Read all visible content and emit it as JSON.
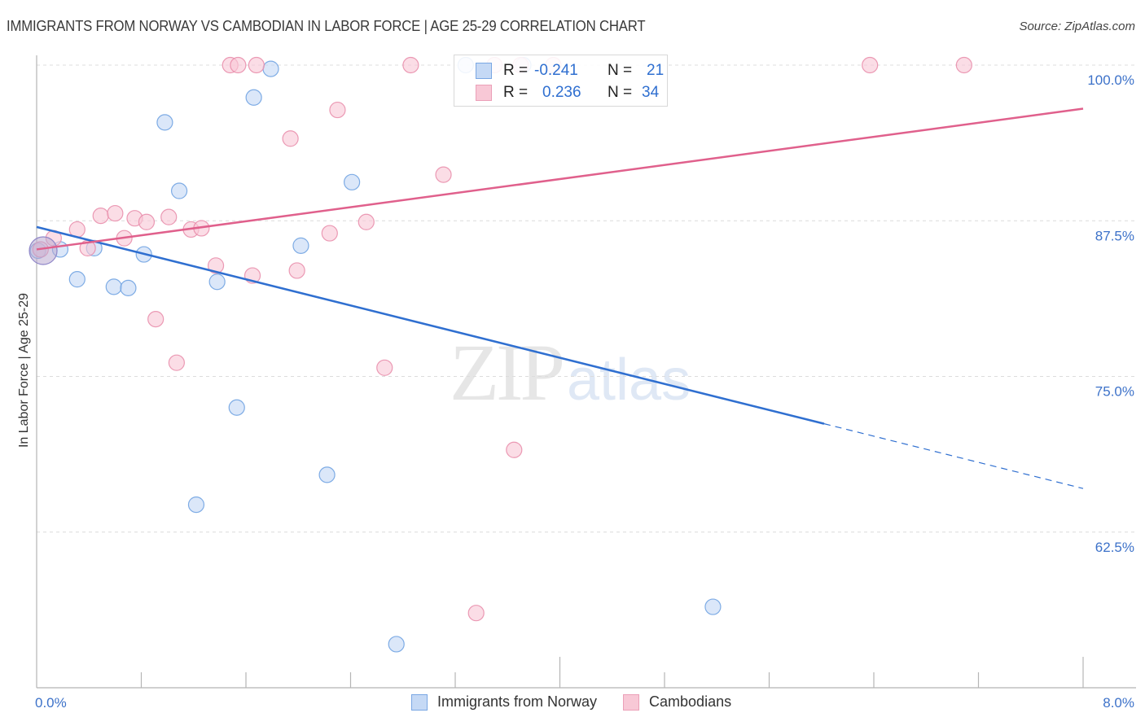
{
  "header": {
    "title": "IMMIGRANTS FROM NORWAY VS CAMBODIAN IN LABOR FORCE | AGE 25-29 CORRELATION CHART",
    "source": "Source: ZipAtlas.com"
  },
  "watermark": {
    "zip": "ZIP",
    "atlas": "atlas"
  },
  "legend": {
    "r_label": "R =",
    "n_label": "N =",
    "series": [
      {
        "name": "Immigrants from Norway",
        "r": "-0.241",
        "n": "21"
      },
      {
        "name": "Cambodians",
        "r": "0.236",
        "n": "34"
      }
    ]
  },
  "chart_data": {
    "type": "scatter",
    "title": "IMMIGRANTS FROM NORWAY VS CAMBODIAN IN LABOR FORCE | AGE 25-29 CORRELATION CHART",
    "xlabel": "",
    "ylabel": "In Labor Force | Age 25-29",
    "xlim": [
      0,
      8
    ],
    "ylim": [
      50,
      101.5
    ],
    "x_tick_labels": [
      "0.0%",
      "8.0%"
    ],
    "y_ticks": [
      100,
      87.5,
      75,
      62.5
    ],
    "y_tick_labels": [
      "100.0%",
      "87.5%",
      "75.0%",
      "62.5%"
    ],
    "grid": true,
    "legend_position": "top-center",
    "series": [
      {
        "name": "Immigrants from Norway",
        "color": "#6a9fe0",
        "fill": "#c5d9f5",
        "r": -0.241,
        "n": 21,
        "points": [
          [
            0.01,
            85.1
          ],
          [
            0.18,
            85.2
          ],
          [
            0.31,
            82.8
          ],
          [
            0.44,
            85.3
          ],
          [
            0.59,
            82.2
          ],
          [
            0.7,
            82.1
          ],
          [
            0.82,
            84.8
          ],
          [
            0.98,
            95.4
          ],
          [
            1.09,
            89.9
          ],
          [
            1.22,
            64.7
          ],
          [
            1.38,
            82.6
          ],
          [
            1.53,
            72.5
          ],
          [
            1.66,
            97.4
          ],
          [
            1.79,
            99.7
          ],
          [
            2.02,
            85.5
          ],
          [
            2.22,
            67.1
          ],
          [
            2.41,
            90.6
          ],
          [
            2.75,
            53.5
          ],
          [
            3.28,
            100.0
          ],
          [
            3.72,
            100.0
          ],
          [
            5.17,
            56.5
          ]
        ],
        "trend": {
          "start": [
            0,
            87.0
          ],
          "solid_end": [
            6.02,
            71.2
          ],
          "end": [
            8,
            66.0
          ],
          "color": "#2f6fd0"
        }
      },
      {
        "name": "Cambodians",
        "color": "#e88aa8",
        "fill": "#f8c8d6",
        "r": 0.236,
        "n": 34,
        "points": [
          [
            0.03,
            85.2
          ],
          [
            0.13,
            86.1
          ],
          [
            0.31,
            86.8
          ],
          [
            0.39,
            85.3
          ],
          [
            0.49,
            87.9
          ],
          [
            0.6,
            88.1
          ],
          [
            0.67,
            86.1
          ],
          [
            0.75,
            87.7
          ],
          [
            0.84,
            87.4
          ],
          [
            0.91,
            79.6
          ],
          [
            1.01,
            87.8
          ],
          [
            1.07,
            76.1
          ],
          [
            1.18,
            86.8
          ],
          [
            1.26,
            86.9
          ],
          [
            1.37,
            83.9
          ],
          [
            1.48,
            100.0
          ],
          [
            1.54,
            100.0
          ],
          [
            1.65,
            83.1
          ],
          [
            1.68,
            100.0
          ],
          [
            1.94,
            94.1
          ],
          [
            1.99,
            83.5
          ],
          [
            2.24,
            86.5
          ],
          [
            2.3,
            96.4
          ],
          [
            2.52,
            87.4
          ],
          [
            2.66,
            75.7
          ],
          [
            2.86,
            100.0
          ],
          [
            3.11,
            91.2
          ],
          [
            3.36,
            56.0
          ],
          [
            3.5,
            100.0
          ],
          [
            3.65,
            69.1
          ],
          [
            3.7,
            100.0
          ],
          [
            3.95,
            100.0
          ],
          [
            6.37,
            100.0
          ],
          [
            7.09,
            100.0
          ]
        ],
        "trend": {
          "start": [
            0,
            85.2
          ],
          "end": [
            8,
            96.5
          ],
          "color": "#e0608c"
        }
      }
    ]
  }
}
